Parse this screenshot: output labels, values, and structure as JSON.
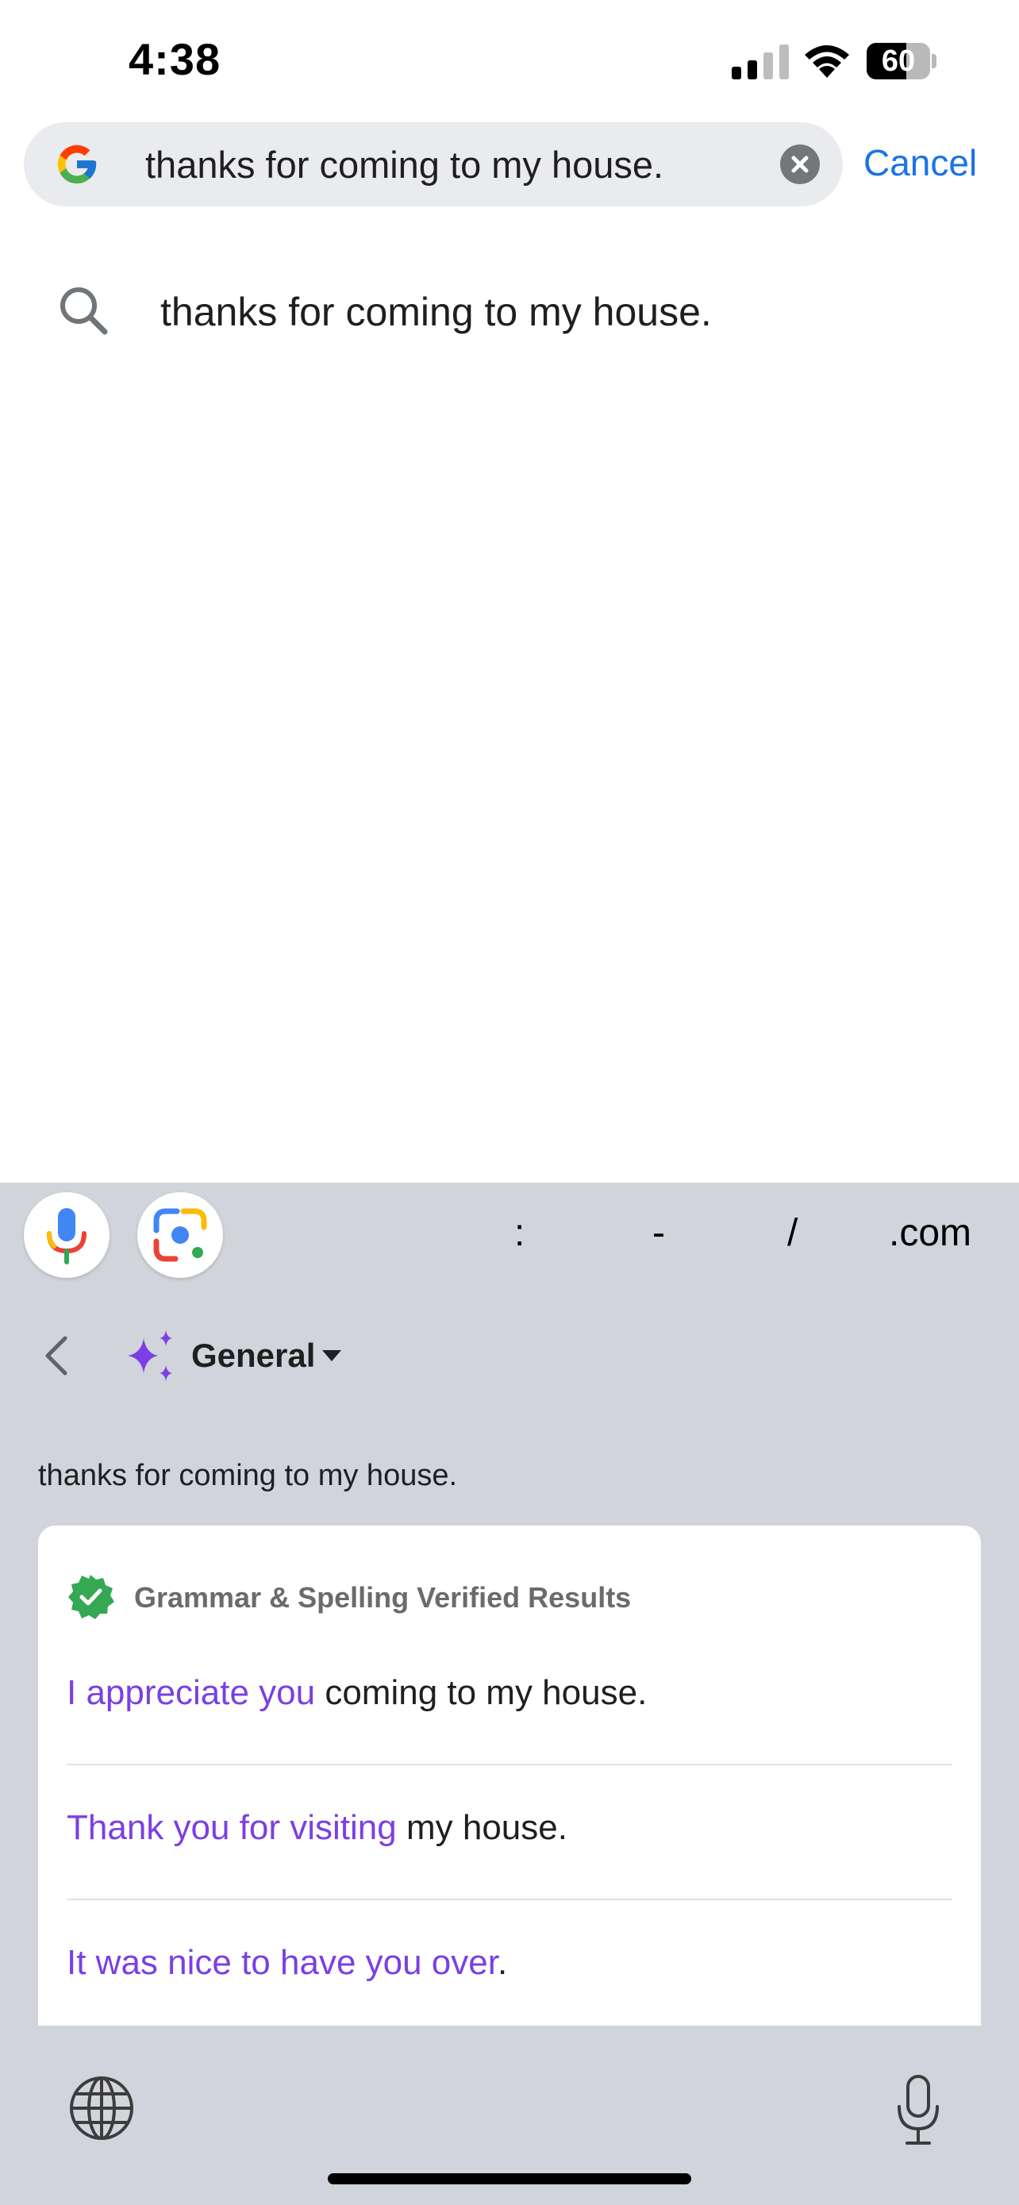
{
  "status_bar": {
    "time": "4:38",
    "battery": "60",
    "signal_icon": "cellular-signal-icon",
    "wifi_icon": "wifi-icon",
    "battery_icon": "battery-icon"
  },
  "search": {
    "query": "thanks for coming to my house.",
    "cancel_label": "Cancel",
    "logo_icon": "google-g-icon",
    "clear_icon": "clear-icon"
  },
  "suggestions": [
    {
      "text": "thanks for coming to my house.",
      "icon": "search-icon"
    }
  ],
  "keyboard": {
    "toolbar_keys": [
      ":",
      "-",
      "/",
      ".com"
    ],
    "mic_icon": "voice-search-icon",
    "lens_icon": "google-lens-icon",
    "mode_label": "General",
    "input_echo": "thanks for coming to my house.",
    "verified_title": "Grammar & Spelling Verified Results",
    "results": [
      {
        "highlight": "I appreciate you",
        "rest": " coming to my house."
      },
      {
        "highlight": "Thank you for visiting",
        "rest": " my house."
      },
      {
        "highlight": "It was nice to have you over",
        "rest": "."
      }
    ],
    "colors": {
      "accent": "#7b3fe4",
      "link": "#1a73e8",
      "verified": "#34a853",
      "keyboard_bg": "#d1d4db"
    }
  }
}
